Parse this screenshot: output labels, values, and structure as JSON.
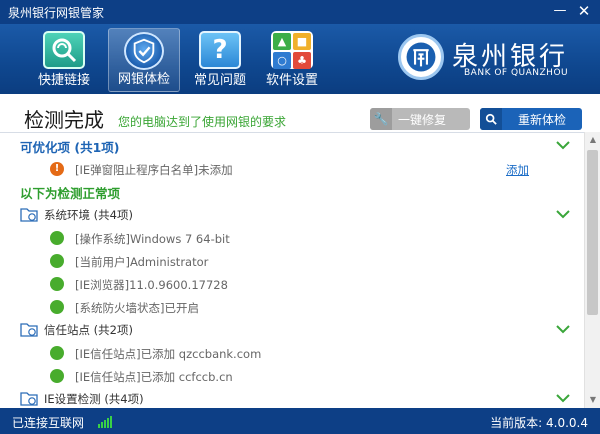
{
  "window": {
    "title": "泉州银行网银管家",
    "minimize": "—",
    "close": "✕"
  },
  "nav": [
    {
      "label": "快捷链接",
      "icon": "shortcut-link-icon"
    },
    {
      "label": "网银体检",
      "icon": "shield-check-icon",
      "active": true
    },
    {
      "label": "常见问题",
      "icon": "question-icon",
      "glyph": "?"
    },
    {
      "label": "软件设置",
      "icon": "settings-grid-icon"
    }
  ],
  "brand": {
    "name": "泉州银行",
    "english": "BANK OF QUANZHOU"
  },
  "result": {
    "title": "检测完成",
    "message": "您的电脑达到了使用网银的要求",
    "repair_button": "一键修复",
    "recheck_button": "重新体检"
  },
  "sections": {
    "optimizable": {
      "title": "可优化项 (共1项)"
    },
    "optimizable_items": [
      {
        "text": "[IE弹窗阻止程序白名单]未添加",
        "action": "添加"
      }
    ],
    "normal": {
      "title": "以下为检测正常项"
    },
    "system_env": {
      "title": "系统环境 (共4项)"
    },
    "system_items": [
      "[操作系统]Windows 7 64-bit",
      "[当前用户]Administrator",
      "[IE浏览器]11.0.9600.17728",
      "[系统防火墙状态]已开启"
    ],
    "trusted_sites": {
      "title": "信任站点 (共2项)"
    },
    "trusted_items": [
      "[IE信任站点]已添加 qzccbank.com",
      "[IE信任站点]已添加 ccfccb.cn"
    ],
    "ie_settings": {
      "title": "IE设置检测 (共4项)"
    }
  },
  "status": {
    "connection": "已连接互联网",
    "version": "当前版本: 4.0.0.4"
  },
  "colors": {
    "primary": "#0d3f86",
    "ok": "#48ac2d",
    "warn": "#e46a16",
    "link": "#1c6dc7"
  }
}
